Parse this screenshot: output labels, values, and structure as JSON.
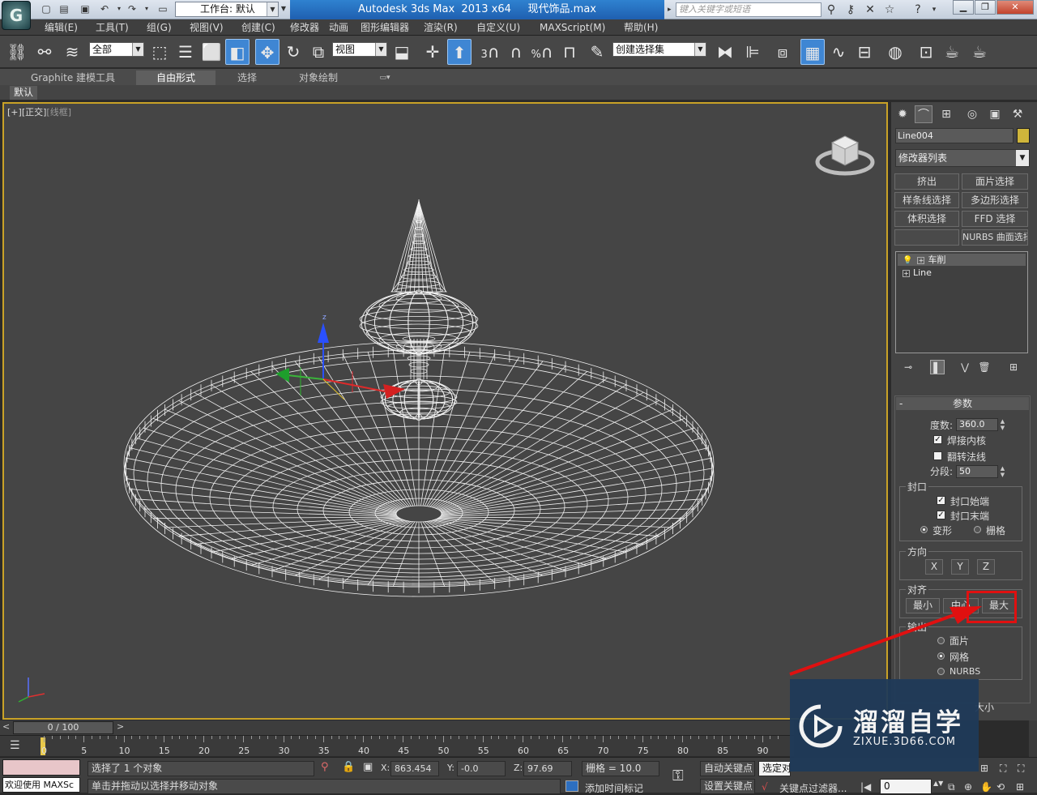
{
  "app": {
    "logo_glyph": "G",
    "title": "Autodesk 3ds Max  2013 x64     现代饰品.max",
    "workspace_label": "工作台: 默认",
    "search_placeholder": "键入关键字或短语",
    "accent": "#2f82d0"
  },
  "menubar": [
    "编辑(E)",
    "工具(T)",
    "组(G)",
    "视图(V)",
    "创建(C)",
    "修改器",
    "动画",
    "图形编辑器",
    "渲染(R)",
    "自定义(U)",
    "MAXScript(M)",
    "帮助(H)"
  ],
  "toolbar": {
    "selection_filter": "全部",
    "coord_system": "视图",
    "snap_label": "3",
    "angle_label": "%",
    "named_selection": "创建选择集"
  },
  "ribbon": {
    "tabs": [
      "Graphite 建模工具",
      "自由形式",
      "选择",
      "对象绘制"
    ],
    "active_tab": "自由形式",
    "row_label": "默认"
  },
  "viewport": {
    "label_plus": "[+]",
    "label_view": "[正交]",
    "label_shading": "[线框]",
    "border_color": "#c9a227",
    "gizmo_axes": [
      "z"
    ]
  },
  "command_panel": {
    "object_name": "Line004",
    "object_color": "#cfb53b",
    "modifier_list": "修改器列表",
    "modifier_buttons": [
      "挤出",
      "面片选择",
      "样条线选择",
      "多边形选择",
      "体积选择",
      "FFD 选择",
      "",
      "NURBS 曲面选择"
    ],
    "stack": [
      {
        "name": "车削",
        "selected": true
      },
      {
        "name": "Line",
        "selected": false
      }
    ]
  },
  "params": {
    "header_minus": "-",
    "title": "参数",
    "degrees_label": "度数:",
    "degrees_value": "360.0",
    "weld_core": {
      "label": "焊接内核",
      "checked": true
    },
    "flip_normals": {
      "label": "翻转法线",
      "checked": false
    },
    "segments_label": "分段:",
    "segments_value": "50",
    "capping": {
      "title": "封口",
      "cap_start": {
        "label": "封口始端",
        "checked": true
      },
      "cap_end": {
        "label": "封口末端",
        "checked": true
      },
      "morph": "变形",
      "grid": "栅格",
      "selected": "变形"
    },
    "direction": {
      "title": "方向",
      "buttons": [
        "X",
        "Y",
        "Z"
      ]
    },
    "align": {
      "title": "对齐",
      "buttons": [
        "最小",
        "中心",
        "最大"
      ]
    },
    "output": {
      "title": "输出",
      "options": [
        "面片",
        "网格",
        "NURBS"
      ],
      "selected": "网格"
    },
    "partial_label": "大小"
  },
  "timeline": {
    "slider_label": "0 / 100",
    "left_arrow": "<",
    "right_arrow": ">",
    "tick_labels": [
      "0",
      "5",
      "10",
      "15",
      "20",
      "25",
      "30",
      "35",
      "40",
      "45",
      "50",
      "55",
      "60",
      "65",
      "70",
      "75",
      "80",
      "85",
      "90"
    ]
  },
  "status": {
    "selected_text": "选择了 1 个对象",
    "prompt_text": "单击并拖动以选择并移动对象",
    "maxscript_text": "欢迎使用 MAXSc",
    "x_label": "X:",
    "x_value": "863.454",
    "y_label": "Y:",
    "y_value": "-0.0",
    "z_label": "Z:",
    "z_value": "97.69",
    "grid_text": "栅格 = 10.0",
    "auto_key": "自动关键点",
    "set_key": "设置关键点",
    "key_mode": "选定对象",
    "add_time_tag": "添加时间标记",
    "key_filters": "关键点过滤器...",
    "frame_value": "0"
  },
  "watermark": {
    "title": "溜溜自学",
    "subtitle": "ZIXUE.3D66.COM"
  }
}
